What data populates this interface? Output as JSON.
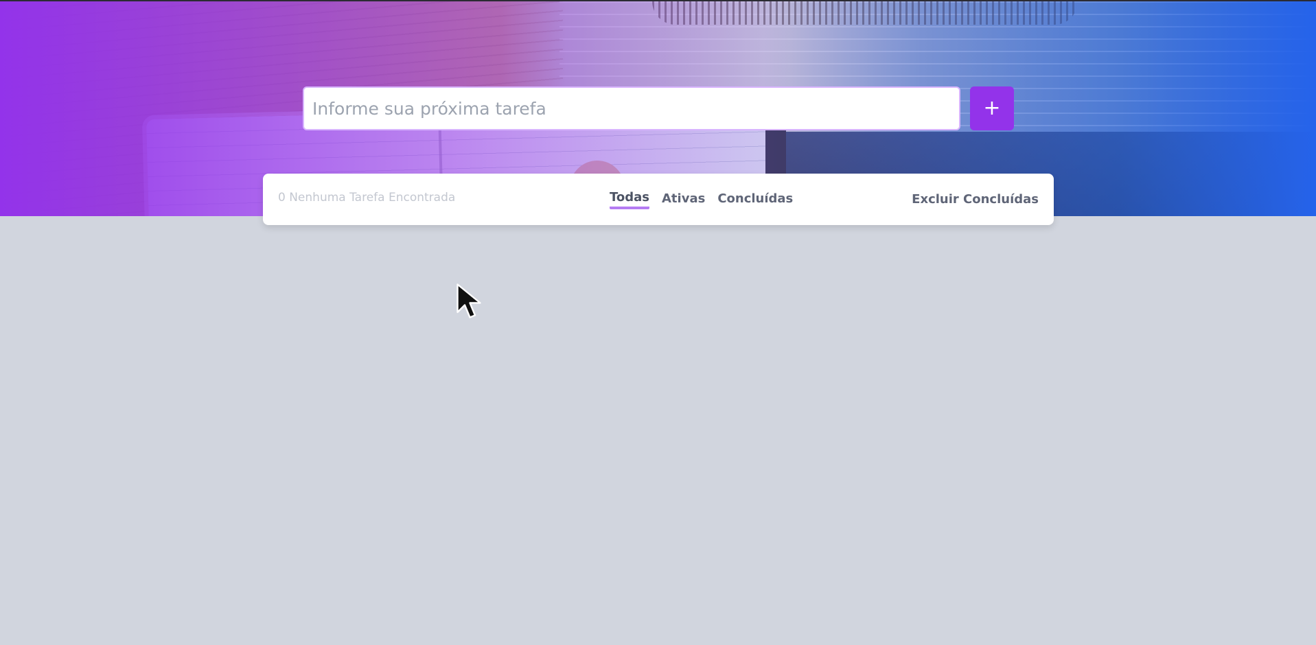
{
  "new_task": {
    "placeholder": "Informe sua próxima tarefa",
    "value": "",
    "add_label": "+"
  },
  "status": {
    "count_text": "0 Nenhuma Tarefa Encontrada"
  },
  "filters": {
    "items": [
      {
        "label": "Todas",
        "active": true
      },
      {
        "label": "Ativas",
        "active": false
      },
      {
        "label": "Concluídas",
        "active": false
      }
    ]
  },
  "actions": {
    "clear_completed_label": "Excluir Concluídas"
  },
  "colors": {
    "accent": "#9333ea",
    "gradient_start": "#9333ea",
    "gradient_end": "#2563eb",
    "background": "#d1d5de",
    "active_underline": "#b57cf3"
  },
  "icons": {
    "add": "plus-icon",
    "pointer": "mouse-cursor-icon"
  }
}
